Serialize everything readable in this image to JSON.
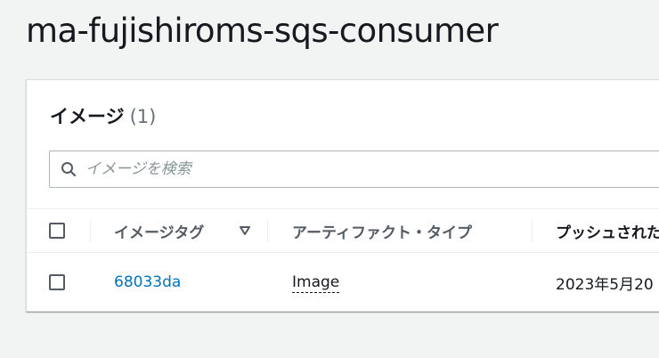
{
  "page": {
    "title": "ma-fujishiroms-sqs-consumer"
  },
  "images_panel": {
    "title": "イメージ",
    "count": "(1)",
    "search": {
      "placeholder": "イメージを検索",
      "value": ""
    },
    "table": {
      "columns": [
        {
          "label": "イメージタグ",
          "sort_icon": "sort-descending-icon"
        },
        {
          "label": "アーティファクト・タイプ"
        },
        {
          "label": "プッシュされた"
        }
      ],
      "rows": [
        {
          "tag": "68033da",
          "artifact_type": "Image",
          "pushed_at": "2023年5月20"
        }
      ]
    }
  },
  "icons": {
    "search": "search-icon",
    "sort": "sort-descending-icon"
  },
  "colors": {
    "background": "#f2f3f3",
    "panel": "#ffffff",
    "link": "#0073bb",
    "header_text": "#545b64"
  }
}
